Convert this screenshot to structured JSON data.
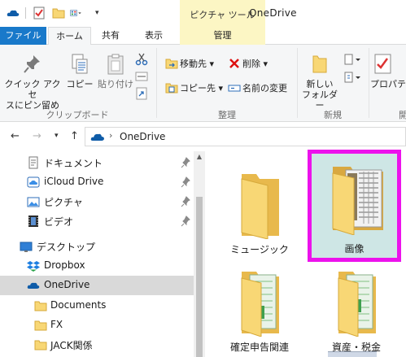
{
  "titlebar": {
    "contextual_tab_label": "ピクチャ ツール",
    "window_title": "OneDrive"
  },
  "ribbon_tabs": {
    "file": "ファイル",
    "home": "ホーム",
    "share": "共有",
    "view": "表示",
    "manage": "管理"
  },
  "clipboard": {
    "pin_quick_access_line1": "クイック アクセ",
    "pin_quick_access_line2": "スにピン留め",
    "copy": "コピー",
    "paste": "貼り付け",
    "group_label": "クリップボード"
  },
  "organize": {
    "move_to": "移動先",
    "copy_to": "コピー先",
    "delete": "削除",
    "rename": "名前の変更",
    "group_label": "整理"
  },
  "new": {
    "new_folder_line1": "新しい",
    "new_folder_line2": "フォルダー",
    "group_label": "新規"
  },
  "open": {
    "properties": "プロパティ",
    "group_label": "開"
  },
  "address": {
    "separator": "›",
    "path": "OneDrive"
  },
  "nav_pane": {
    "items": [
      {
        "label": "ドキュメント",
        "pinned": true
      },
      {
        "label": "iCloud Drive",
        "pinned": true
      },
      {
        "label": "ピクチャ",
        "pinned": true
      },
      {
        "label": "ビデオ",
        "pinned": true
      },
      {
        "label": "デスクトップ",
        "pinned": false
      },
      {
        "label": "Dropbox",
        "pinned": false
      },
      {
        "label": "OneDrive",
        "pinned": false,
        "selected": true
      },
      {
        "label": "Documents",
        "pinned": false
      },
      {
        "label": "FX",
        "pinned": false
      },
      {
        "label": "JACK関係",
        "pinned": false
      }
    ]
  },
  "content": {
    "items": [
      {
        "label": "ミュージック",
        "selected": false
      },
      {
        "label": "画像",
        "selected": true
      },
      {
        "label": "確定申告関連",
        "selected": false
      },
      {
        "label": "資産・税金",
        "selected": false
      }
    ]
  },
  "colors": {
    "file_tab": "#1979ca",
    "contextual_tab": "#fcf6c4",
    "highlight_border": "#ec12ec",
    "selected_nav": "#d9d9d9",
    "folder": "#f8d775"
  }
}
